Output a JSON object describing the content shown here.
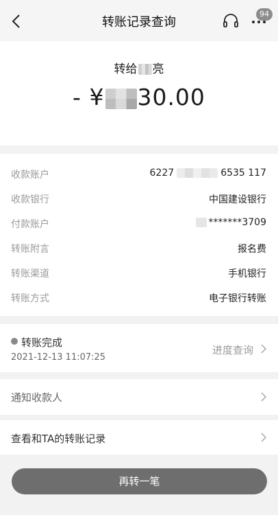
{
  "header": {
    "title": "转账记录查询",
    "badge_count": "94"
  },
  "transfer": {
    "payee_prefix": "转给",
    "payee_visible": "亮",
    "amount_prefix": "- ¥",
    "amount_visible": "30.00"
  },
  "details": [
    {
      "label": "收款账户",
      "value_prefix": "6227",
      "value_suffix": "6535 117"
    },
    {
      "label": "收款银行",
      "value": "中国建设银行"
    },
    {
      "label": "付款账户",
      "value": "*******3709"
    },
    {
      "label": "转账附言",
      "value": "报名费"
    },
    {
      "label": "转账渠道",
      "value": "手机银行"
    },
    {
      "label": "转账方式",
      "value": "电子银行转账"
    }
  ],
  "status": {
    "text": "转账完成",
    "time": "2021-12-13 11:07:25",
    "query_label": "进度查询"
  },
  "actions": {
    "notify_label": "通知收款人",
    "history_label": "查看和TA的转账记录",
    "again_label": "再转一笔"
  },
  "colors": {
    "page_bg": "#f2f2f2",
    "button_bg": "#6e6e6e",
    "label_gray": "#9a9a9a"
  }
}
